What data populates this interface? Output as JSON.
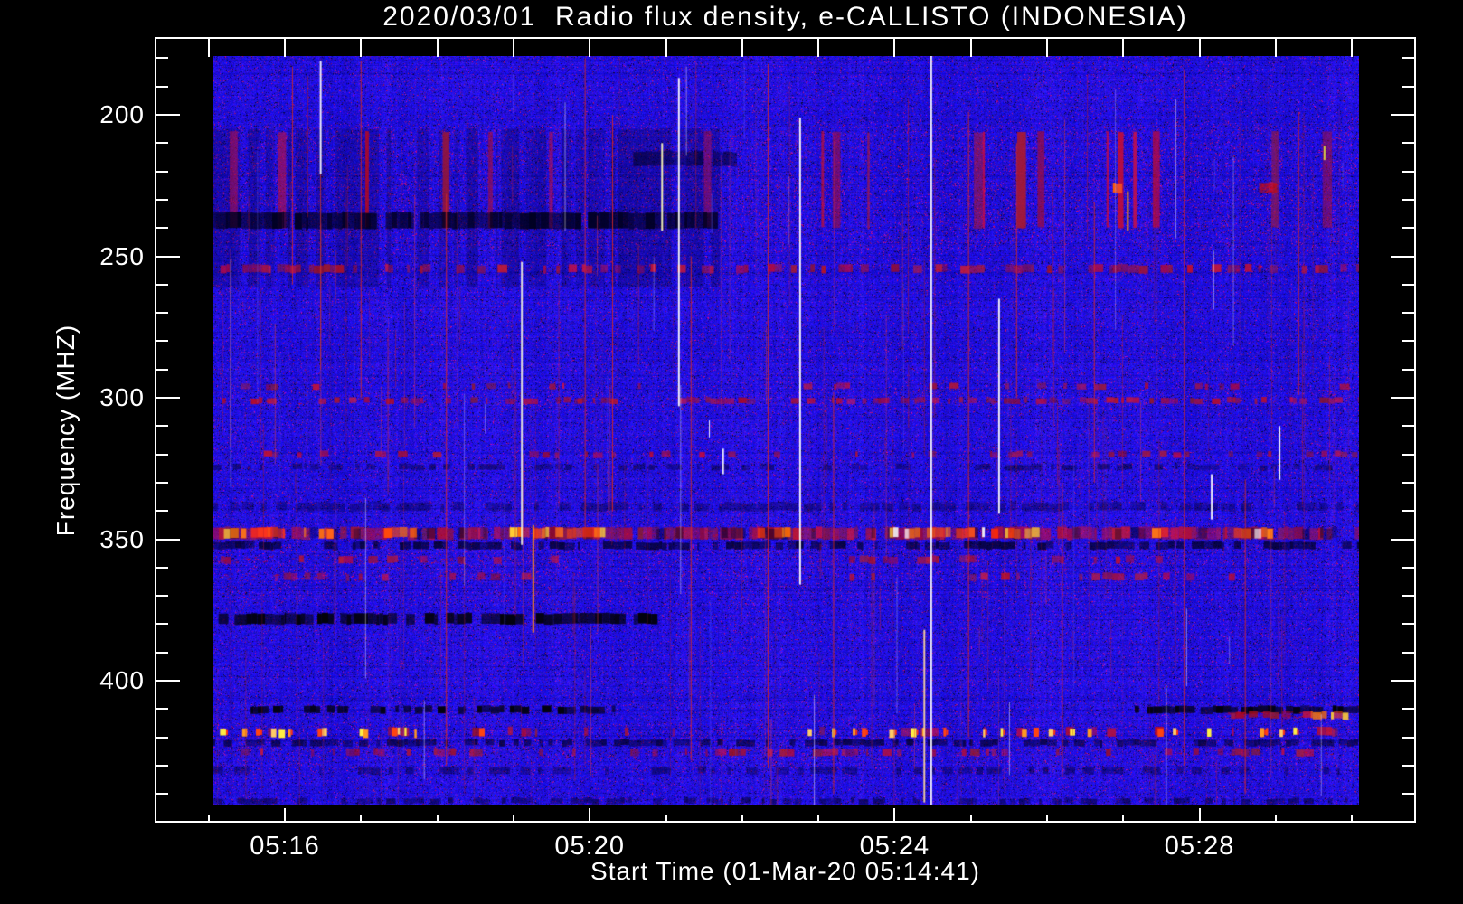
{
  "title": "2020/03/01  Radio flux density, e-CALLISTO (INDONESIA)",
  "x_axis": {
    "label": "Start Time (01-Mar-20 05:14:41)",
    "major_ticks": [
      {
        "minute": 16,
        "label": "05:16"
      },
      {
        "minute": 20,
        "label": "05:20"
      },
      {
        "minute": 24,
        "label": "05:24"
      },
      {
        "minute": 28,
        "label": "05:28"
      }
    ],
    "minor_tick_minutes": [
      15,
      16,
      17,
      18,
      19,
      20,
      21,
      22,
      23,
      24,
      25,
      26,
      27,
      28,
      29,
      30
    ]
  },
  "y_axis": {
    "label": "Frequency (MHZ)",
    "major_ticks": [
      200,
      250,
      300,
      350,
      400
    ],
    "minor_tick_step": 10,
    "minor_tick_range": [
      180,
      440
    ]
  },
  "chart_data": {
    "type": "heatmap",
    "title": "2020/03/01  Radio flux density, e-CALLISTO (INDONESIA)",
    "xlabel": "Start Time (01-Mar-20 05:14:41)",
    "ylabel": "Frequency (MHZ)",
    "station": "INDONESIA",
    "date": "2020/03/01",
    "start_time": "05:14:41",
    "x_range_minutes_after_0500": [
      15.06,
      30.1
    ],
    "y_range_mhz": [
      179,
      444.5
    ],
    "legend": "none",
    "grid": false,
    "colors": {
      "quiet_background": "#2121d9",
      "quiet_dark": "#000030",
      "rfi_red": "#c42222",
      "rfi_bright": "#ff5510",
      "rfi_spark": "#ffdd40",
      "axis": "#ffffff",
      "page_background": "#000000"
    },
    "bands": [
      {
        "name": "subtle-dark-top-left",
        "f": [
          205,
          261
        ],
        "segments": [
          [
            15.06,
            21.6
          ]
        ],
        "type": "darken",
        "alpha": 0.16,
        "density": 0.7
      },
      {
        "name": "red-texture-210-240mhz",
        "f": [
          206,
          240
        ],
        "segments": [
          [
            15.06,
            30.1
          ]
        ],
        "type": "red",
        "density": 0.1
      },
      {
        "name": "dark-streak-236mhz",
        "f": [
          234.5,
          240.2
        ],
        "segments": [
          [
            15.06,
            21.6
          ]
        ],
        "type": "darken",
        "alpha": 0.6,
        "density": 0.95
      },
      {
        "name": "dark-strip-215mhz",
        "f": [
          213,
          218
        ],
        "segments": [
          [
            20.57,
            21.87
          ]
        ],
        "type": "darken",
        "alpha": 0.38,
        "density": 0.9
      },
      {
        "name": "orange-blob-225mhz",
        "f": [
          224,
          227.5
        ],
        "segments": [
          [
            26.76,
            26.98
          ]
        ],
        "type": "bright",
        "density": 0.9
      },
      {
        "name": "darkred-blob-225mhz",
        "f": [
          224,
          227.5
        ],
        "segments": [
          [
            28.78,
            29.0
          ]
        ],
        "type": "red",
        "density": 0.85
      },
      {
        "name": "red-line-254mhz",
        "f": [
          253,
          255.8
        ],
        "segments": [
          [
            15.06,
            30.1
          ]
        ],
        "type": "red",
        "density": 0.5
      },
      {
        "name": "red-line-296mhz-faint",
        "f": [
          295,
          297
        ],
        "segments": [
          [
            15.06,
            30.1
          ]
        ],
        "type": "red",
        "density": 0.13
      },
      {
        "name": "red-line-300mhz",
        "f": [
          300,
          302
        ],
        "segments": [
          [
            15.06,
            30.1
          ]
        ],
        "type": "red",
        "density": 0.45
      },
      {
        "name": "red-row-320mhz",
        "f": [
          319,
          321
        ],
        "segments": [
          [
            15.06,
            30.1
          ]
        ],
        "type": "red",
        "density": 0.22
      },
      {
        "name": "dark-row-324mhz",
        "f": [
          323.5,
          325.5
        ],
        "segments": [
          [
            15.06,
            30.1
          ]
        ],
        "type": "darken",
        "alpha": 0.3,
        "density": 0.5
      },
      {
        "name": "dark-band-338mhz",
        "f": [
          337,
          340
        ],
        "segments": [
          [
            15.06,
            30.1
          ]
        ],
        "type": "darken",
        "alpha": 0.25,
        "density": 0.6
      },
      {
        "name": "rfi-band-347mhz",
        "f": [
          345.8,
          350
        ],
        "segments": [
          [
            15.06,
            30.1
          ]
        ],
        "type": "red",
        "density": 0.8
      },
      {
        "name": "rfi-band-347mhz-dark-gaps",
        "f": [
          346,
          349.8
        ],
        "segments": [
          [
            15.06,
            30.1
          ]
        ],
        "type": "darken",
        "alpha": 0.35,
        "density": 0.25
      },
      {
        "name": "rfi-band-347mhz-bright",
        "f": [
          346,
          349.5
        ],
        "type": "bright",
        "density": 0.85,
        "segments": [
          [
            15.2,
            16.0
          ],
          [
            16.25,
            16.6
          ],
          [
            17.3,
            17.7
          ],
          [
            18.95,
            19.45
          ],
          [
            19.55,
            20.15
          ],
          [
            22.2,
            22.6
          ],
          [
            23.85,
            25.35
          ],
          [
            25.45,
            25.95
          ],
          [
            27.2,
            27.5
          ],
          [
            28.45,
            28.95
          ]
        ]
      },
      {
        "name": "dark-row-352mhz",
        "f": [
          351,
          353.5
        ],
        "segments": [
          [
            15.06,
            30.1
          ]
        ],
        "type": "darken",
        "alpha": 0.5,
        "density": 0.7
      },
      {
        "name": "darkred-row-357mhz",
        "f": [
          356,
          358.5
        ],
        "segments": [
          [
            15.1,
            19.6
          ],
          [
            23.4,
            27.6
          ]
        ],
        "type": "red",
        "density": 0.3
      },
      {
        "name": "darkred-row-363mhz",
        "f": [
          362,
          364.5
        ],
        "segments": [
          [
            15.2,
            19.3
          ],
          [
            23.2,
            28.9
          ]
        ],
        "type": "red",
        "density": 0.3
      },
      {
        "name": "black-band-378mhz",
        "f": [
          376.3,
          380
        ],
        "segments": [
          [
            15.06,
            20.84
          ]
        ],
        "type": "black",
        "density": 0.85
      },
      {
        "name": "black-band-410mhz-left",
        "f": [
          409,
          411.5
        ],
        "segments": [
          [
            15.23,
            20.33
          ]
        ],
        "type": "black",
        "density": 0.6
      },
      {
        "name": "black-band-410mhz-right",
        "f": [
          409,
          411.5
        ],
        "segments": [
          [
            27.15,
            30.1
          ]
        ],
        "type": "black",
        "density": 0.92
      },
      {
        "name": "darkred-412mhz",
        "f": [
          411,
          413.2
        ],
        "segments": [
          [
            28.3,
            29.4
          ]
        ],
        "type": "red",
        "density": 0.6
      },
      {
        "name": "bright-red-segment-412mhz",
        "f": [
          411,
          413.5
        ],
        "segments": [
          [
            29.46,
            29.9
          ]
        ],
        "type": "bright",
        "density": 0.95
      },
      {
        "name": "red-row-418mhz",
        "f": [
          416.5,
          419.5
        ],
        "segments": [
          [
            15.06,
            30.1
          ]
        ],
        "type": "red",
        "density": 0.15
      },
      {
        "name": "dark-row-421mhz",
        "f": [
          420.8,
          423
        ],
        "segments": [
          [
            15.06,
            30.1
          ]
        ],
        "type": "darken",
        "alpha": 0.45,
        "density": 0.6
      },
      {
        "name": "red-row-425mhz",
        "f": [
          424,
          426.5
        ],
        "segments": [
          [
            15.06,
            30.1
          ]
        ],
        "type": "red",
        "density": 0.3
      },
      {
        "name": "dark-row-431mhz",
        "f": [
          430.5,
          433
        ],
        "segments": [
          [
            15.06,
            30.1
          ]
        ],
        "type": "darken",
        "alpha": 0.3,
        "density": 0.35
      },
      {
        "name": "dark-row-442mhz",
        "f": [
          441.5,
          443.5
        ],
        "segments": [
          [
            15.06,
            30.1
          ]
        ],
        "type": "darken",
        "alpha": 0.35,
        "density": 0.4
      }
    ],
    "sparks_418mhz": {
      "f": [
        416.5,
        419.8
      ],
      "minutes": [
        15.15,
        15.44,
        15.62,
        15.82,
        15.92,
        16.04,
        16.43,
        16.49,
        16.98,
        17.03,
        17.4,
        17.48,
        17.57,
        17.7,
        18.55,
        22.86,
        23.18,
        23.45,
        23.57,
        23.93,
        24.21,
        24.36,
        24.64,
        25.16,
        25.39,
        25.67,
        25.82,
        26.02,
        26.3,
        26.53,
        27.45,
        27.65,
        28.1,
        28.79,
        28.87,
        29.05,
        29.23
      ],
      "palette": [
        "#ffee44",
        "#ff9922",
        "#ff4411",
        "#ffcc66"
      ]
    },
    "verticals": [
      {
        "t": 16.47,
        "f": [
          181,
          221
        ],
        "color": "#ffffff",
        "w": 2
      },
      {
        "t": 16.47,
        "f": [
          221,
          290
        ],
        "color": "#bb3333",
        "w": 1
      },
      {
        "t": 19.11,
        "f": [
          252,
          352
        ],
        "color": "#f0f0e0",
        "w": 2
      },
      {
        "t": 19.26,
        "f": [
          345,
          383
        ],
        "color": "#ff8811",
        "w": 2
      },
      {
        "t": 20.95,
        "f": [
          210,
          241
        ],
        "color": "#ffffbb",
        "w": 2
      },
      {
        "t": 21.17,
        "f": [
          187,
          303
        ],
        "color": "#ffffff",
        "w": 2
      },
      {
        "t": 21.57,
        "f": [
          308,
          314
        ],
        "color": "#ffffff",
        "w": 1
      },
      {
        "t": 21.75,
        "f": [
          318,
          327
        ],
        "color": "#ffffff",
        "w": 2
      },
      {
        "t": 22.76,
        "f": [
          201,
          366
        ],
        "color": "#ffffff",
        "w": 2
      },
      {
        "t": 24.39,
        "f": [
          382,
          443
        ],
        "color": "#ffd9a0",
        "w": 2
      },
      {
        "t": 24.48,
        "f": [
          178,
          444
        ],
        "color": "#ffffff",
        "w": 2
      },
      {
        "t": 25.37,
        "f": [
          265,
          341
        ],
        "color": "#ffffff",
        "w": 2
      },
      {
        "t": 27.06,
        "f": [
          227,
          241
        ],
        "color": "#ff9900",
        "w": 2
      },
      {
        "t": 28.16,
        "f": [
          327,
          343
        ],
        "color": "#ffffff",
        "w": 2
      },
      {
        "t": 29.05,
        "f": [
          310,
          329
        ],
        "color": "#ffffff",
        "w": 2
      },
      {
        "t": 29.64,
        "f": [
          211,
          216
        ],
        "color": "#dddd44",
        "w": 2
      },
      {
        "t": 16.1,
        "f": [
          183,
          260
        ],
        "color": "#cc2828",
        "w": 1
      },
      {
        "t": 17.0,
        "f": [
          181,
          300
        ],
        "color": "#cc2828",
        "w": 1
      },
      {
        "t": 18.12,
        "f": [
          228,
          430
        ],
        "color": "#cc2828",
        "w": 1
      },
      {
        "t": 19.94,
        "f": [
          180,
          350
        ],
        "color": "#cc2828",
        "w": 1
      },
      {
        "t": 20.3,
        "f": [
          200,
          340
        ],
        "color": "#cc2828",
        "w": 1
      },
      {
        "t": 21.33,
        "f": [
          250,
          428
        ],
        "color": "#cc2828",
        "w": 1
      },
      {
        "t": 22.34,
        "f": [
          182,
          431
        ],
        "color": "#cc2828",
        "w": 1
      },
      {
        "t": 23.2,
        "f": [
          298,
          440
        ],
        "color": "#cc2828",
        "w": 1
      },
      {
        "t": 24.97,
        "f": [
          199,
          420
        ],
        "color": "#cc2828",
        "w": 1
      },
      {
        "t": 25.6,
        "f": [
          210,
          300
        ],
        "color": "#cc2828",
        "w": 1
      },
      {
        "t": 26.2,
        "f": [
          330,
          434
        ],
        "color": "#cc2828",
        "w": 1
      },
      {
        "t": 26.62,
        "f": [
          231,
          330
        ],
        "color": "#cc2828",
        "w": 1
      },
      {
        "t": 27.8,
        "f": [
          184,
          430
        ],
        "color": "#cc2828",
        "w": 1
      },
      {
        "t": 28.6,
        "f": [
          329,
          440
        ],
        "color": "#cc2828",
        "w": 1
      },
      {
        "t": 29.3,
        "f": [
          199,
          299
        ],
        "color": "#cc2828",
        "w": 1
      }
    ]
  }
}
